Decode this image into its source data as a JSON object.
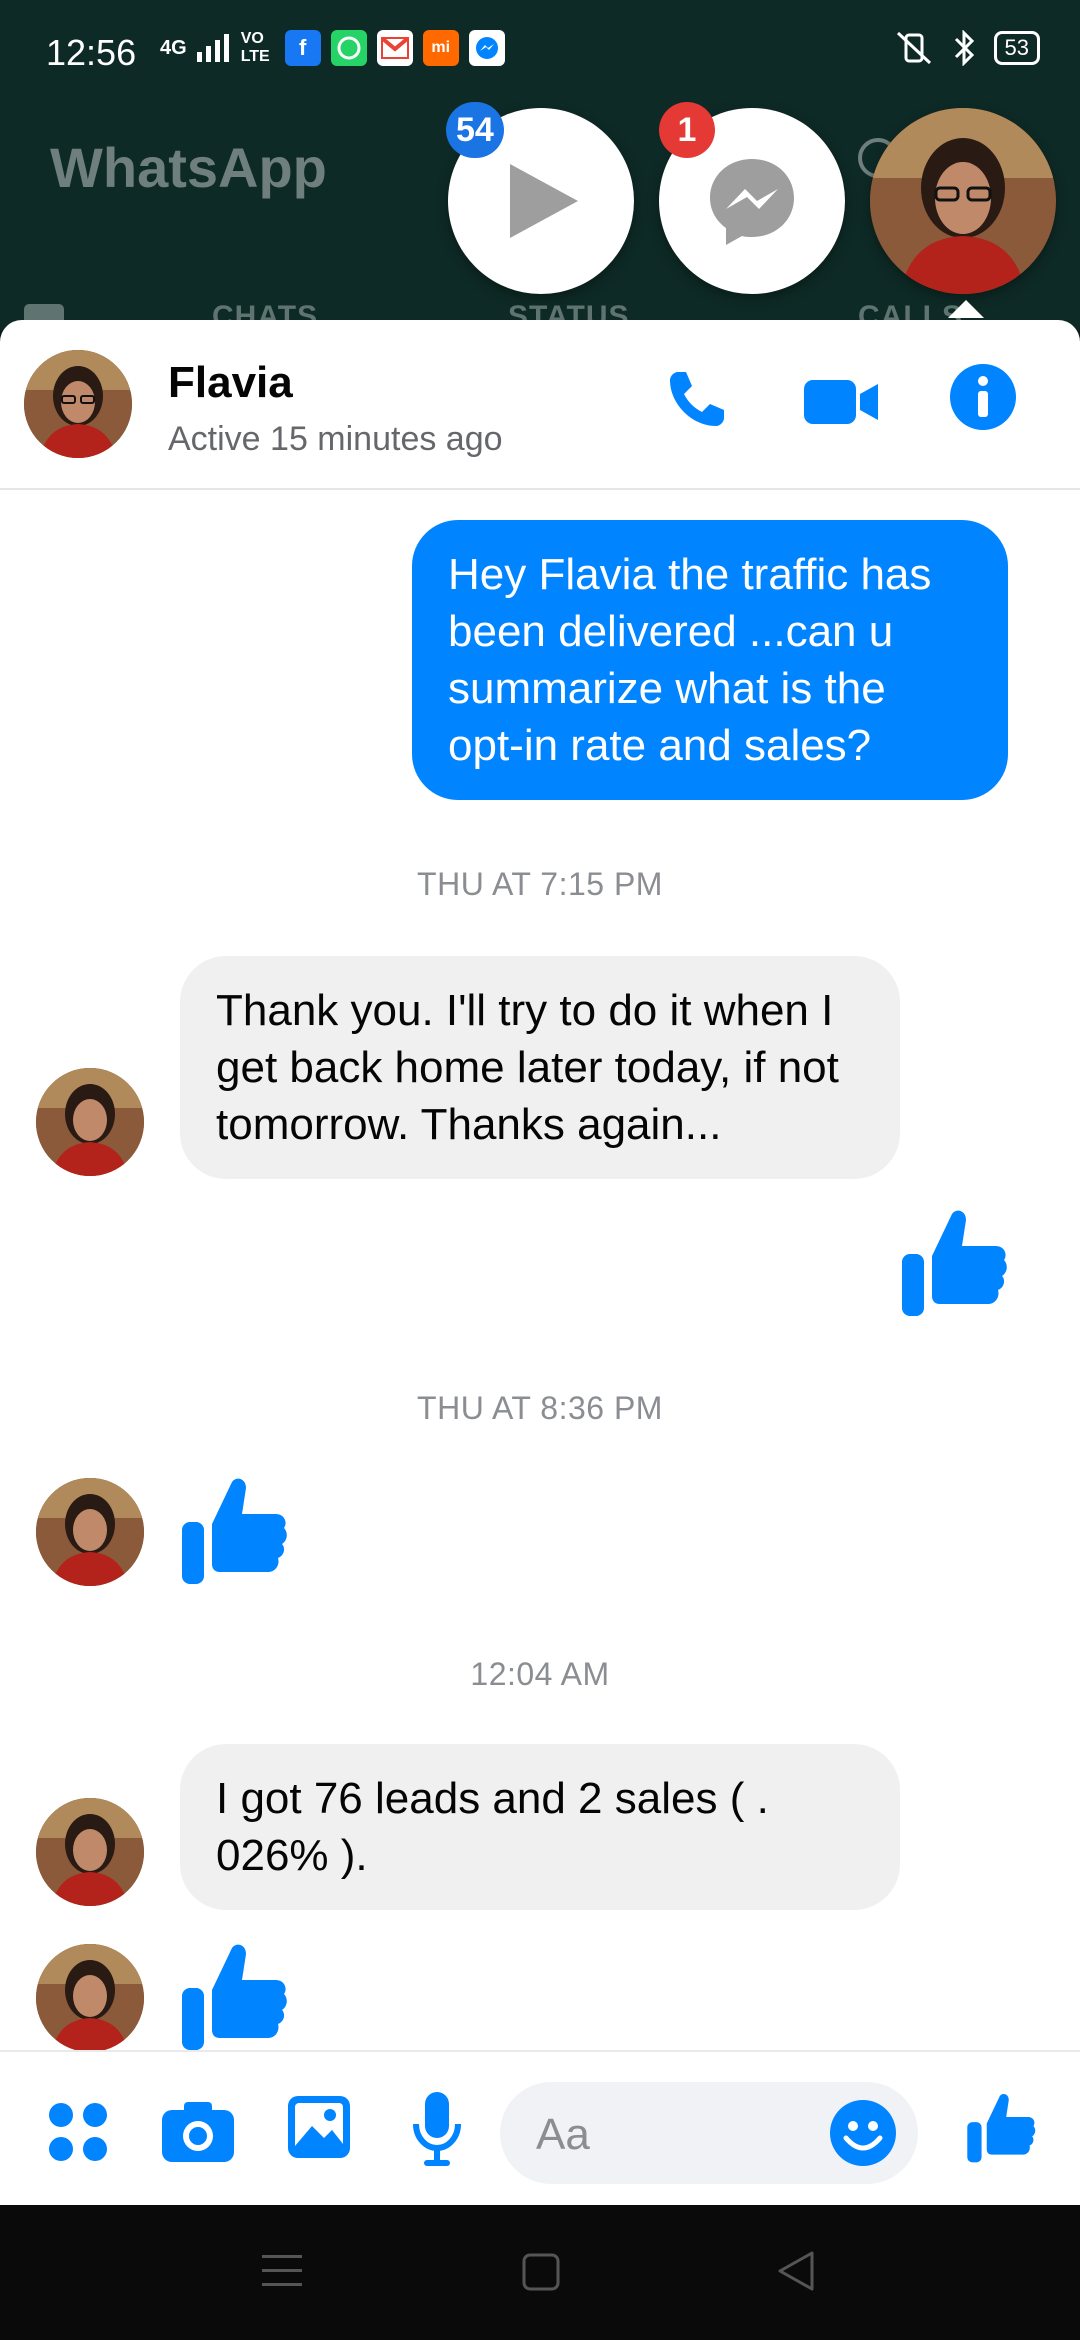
{
  "status_bar": {
    "time": "12:56",
    "network": "4G",
    "volte": "VO LTE",
    "battery": "53"
  },
  "background_app": {
    "title": "WhatsApp",
    "tabs": [
      "CHATS",
      "STATUS",
      "CALLS"
    ]
  },
  "chat_heads": {
    "video_badge": "54",
    "messenger_badge": "1"
  },
  "colors": {
    "messenger_blue": "#0084ff",
    "incoming_bubble": "#f0f0f0",
    "badge_red": "#e53935"
  },
  "conversation": {
    "contact_name": "Flavia",
    "contact_status": "Active 15 minutes ago",
    "messages": {
      "out_1": "Hey Flavia the traffic has been delivered ...can u summarize what is the opt-in rate and sales?",
      "ts_1": "THU AT 7:15 PM",
      "in_1": "Thank you. I'll try to do it when I get back home later today, if not tomorrow. Thanks again...",
      "ts_2": "THU AT 8:36 PM",
      "ts_3": "12:04 AM",
      "in_2": "I got 76 leads and 2 sales ( . 026% )."
    }
  },
  "composer": {
    "placeholder": "Aa"
  },
  "icons": [
    "phone-icon",
    "video-call-icon",
    "info-icon",
    "menu-grid-icon",
    "camera-icon",
    "gallery-icon",
    "microphone-icon",
    "emoji-icon",
    "like-icon"
  ]
}
